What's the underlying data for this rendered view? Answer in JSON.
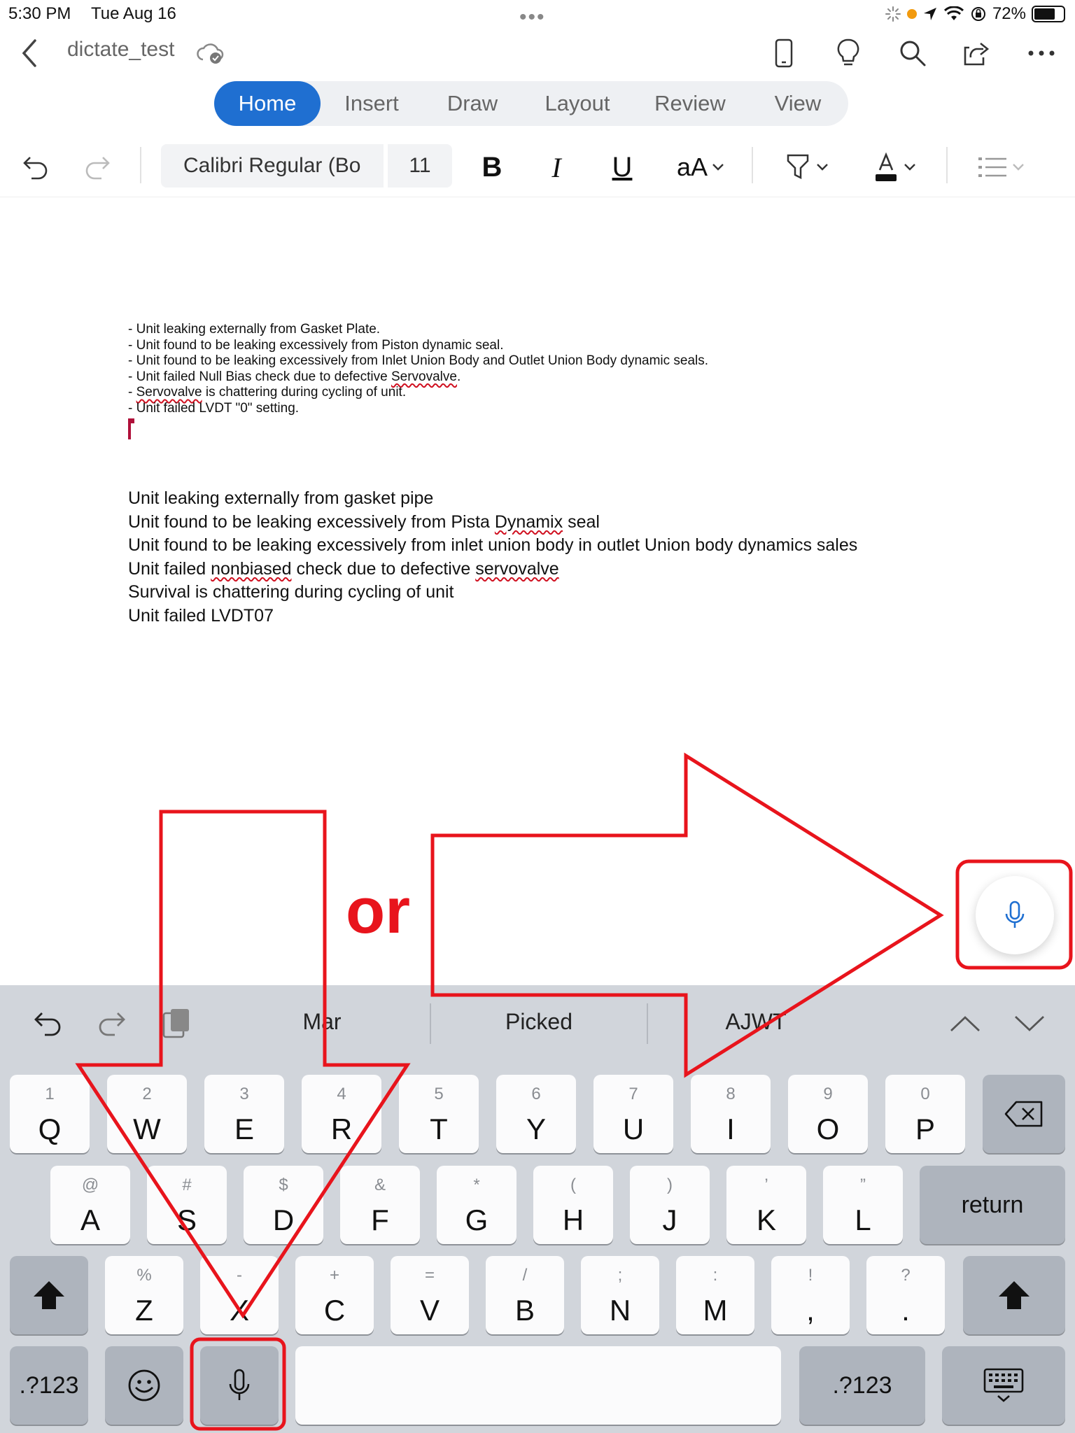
{
  "status_bar": {
    "time": "5:30 PM",
    "date": "Tue Aug 16",
    "battery_percent": "72%",
    "battery_level": 0.72
  },
  "title_bar": {
    "document_name": "dictate_test",
    "icons": [
      "back-chevron-icon",
      "cloud-sync-icon",
      "phone-view-icon",
      "lightbulb-icon",
      "search-icon",
      "share-icon",
      "more-icon"
    ]
  },
  "tabs": [
    {
      "label": "Home",
      "active": true
    },
    {
      "label": "Insert",
      "active": false
    },
    {
      "label": "Draw",
      "active": false
    },
    {
      "label": "Layout",
      "active": false
    },
    {
      "label": "Review",
      "active": false
    },
    {
      "label": "View",
      "active": false
    }
  ],
  "ribbon": {
    "font_name": "Calibri Regular (Bo",
    "font_size": "11",
    "bold": "B",
    "italic": "I",
    "underline": "U",
    "text_size": "aA"
  },
  "document": {
    "original_lines": [
      "- Unit leaking externally from Gasket Plate.",
      "- Unit found to be leaking excessively from Piston dynamic seal.",
      "- Unit found to be leaking excessively from Inlet Union Body and Outlet Union Body dynamic seals.",
      "- Unit failed Null Bias check due to defective ",
      "Servovalve",
      ".",
      "- ",
      "Servovalve",
      " is chattering during cycling of unit.",
      "- Unit failed LVDT \"0\" setting."
    ],
    "dictated_lines": [
      "Unit leaking externally from gasket pipe",
      "Unit found to be leaking excessively from Pista ",
      "Dynamix",
      " seal",
      "Unit found to be leaking excessively from inlet union body in outlet Union body dynamics sales",
      "Unit failed ",
      "nonbiased",
      " check due to defective ",
      "servovalve",
      "Survival is chattering during cycling of unit",
      "Unit failed LVDT07"
    ]
  },
  "keyboard": {
    "suggestions": [
      "Mar",
      "Picked",
      "AJWT"
    ],
    "row1": [
      {
        "main": "Q",
        "sub": "1"
      },
      {
        "main": "W",
        "sub": "2"
      },
      {
        "main": "E",
        "sub": "3"
      },
      {
        "main": "R",
        "sub": "4"
      },
      {
        "main": "T",
        "sub": "5"
      },
      {
        "main": "Y",
        "sub": "6"
      },
      {
        "main": "U",
        "sub": "7"
      },
      {
        "main": "I",
        "sub": "8"
      },
      {
        "main": "O",
        "sub": "9"
      },
      {
        "main": "P",
        "sub": "0"
      }
    ],
    "row2": [
      {
        "main": "A",
        "sub": "@"
      },
      {
        "main": "S",
        "sub": "#"
      },
      {
        "main": "D",
        "sub": "$"
      },
      {
        "main": "F",
        "sub": "&"
      },
      {
        "main": "G",
        "sub": "*"
      },
      {
        "main": "H",
        "sub": "("
      },
      {
        "main": "J",
        "sub": ")"
      },
      {
        "main": "K",
        "sub": "’"
      },
      {
        "main": "L",
        "sub": "”"
      }
    ],
    "row3": [
      {
        "main": "Z",
        "sub": "%"
      },
      {
        "main": "X",
        "sub": "-"
      },
      {
        "main": "C",
        "sub": "+"
      },
      {
        "main": "V",
        "sub": "="
      },
      {
        "main": "B",
        "sub": "/"
      },
      {
        "main": "N",
        "sub": ";"
      },
      {
        "main": "M",
        "sub": ":"
      },
      {
        "main": ",",
        "sub": "!"
      },
      {
        "main": ".",
        "sub": "?"
      }
    ],
    "return_label": "return",
    "numbers_label": ".?123"
  },
  "annotation": {
    "or_text": "or",
    "color": "#e8141c"
  }
}
